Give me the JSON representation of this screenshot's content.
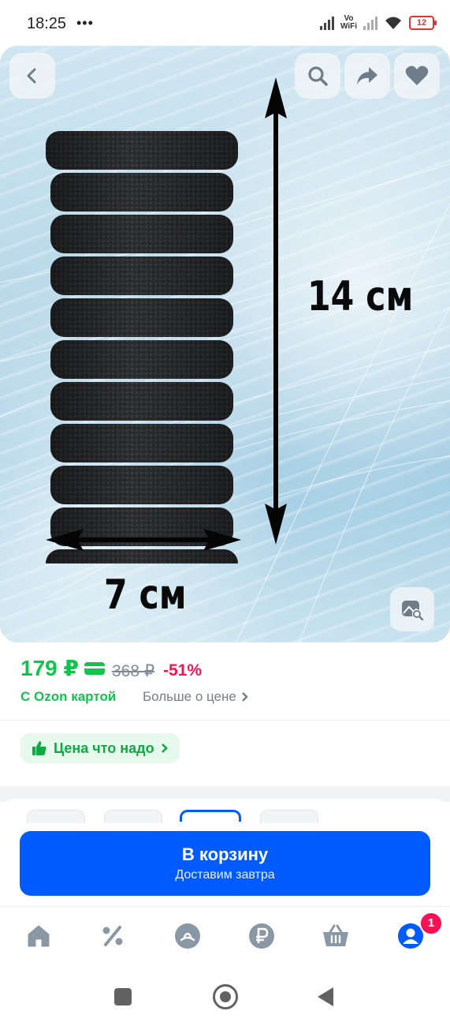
{
  "status_bar": {
    "time": "18:25",
    "extras": "•••",
    "vowifi_top": "Vo",
    "vowifi_bottom": "WiFi",
    "battery": "12"
  },
  "hero": {
    "height_label": "14 см",
    "width_label": "7 см",
    "buttons": [
      "back-icon",
      "search-icon",
      "share-icon",
      "heart-icon",
      "image-search-icon"
    ]
  },
  "price": {
    "current": "179 ₽",
    "old": "368 ₽",
    "discount": "-51%",
    "ozon_card": "С Ozon картой",
    "more_link": "Больше о цене",
    "badge": "Цена что надо"
  },
  "cart": {
    "title": "В корзину",
    "subtitle": "Доставим завтра"
  },
  "bottom_nav": {
    "items": [
      "home-icon",
      "discount-icon",
      "catalog-icon",
      "ruble-icon",
      "basket-icon",
      "profile-icon"
    ],
    "profile_badge": "1"
  },
  "colors": {
    "price_green": "#10c44c",
    "discount_pink": "#f91155",
    "cart_blue": "#005bff",
    "nav_gray": "#8a98a6"
  }
}
